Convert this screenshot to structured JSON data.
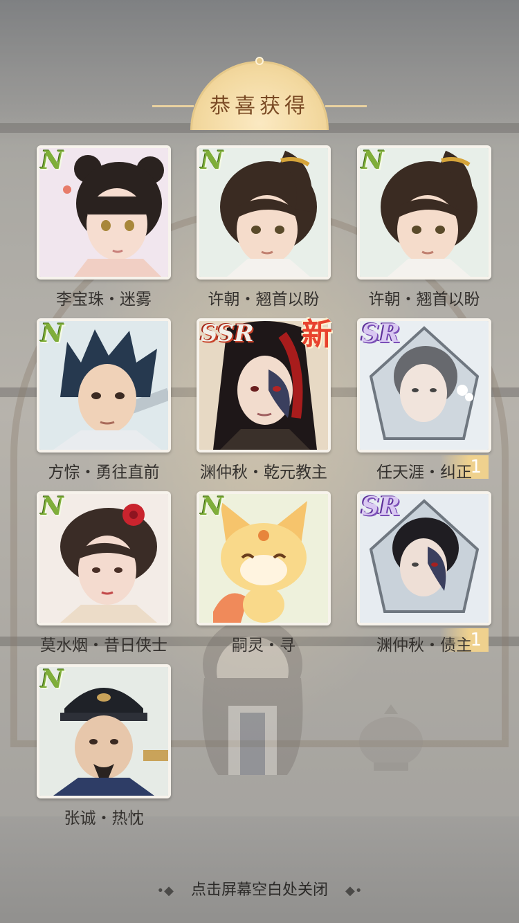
{
  "title": "恭喜获得",
  "footer_hint": "点击屏幕空白处关闭",
  "cards": [
    {
      "rarity": "N",
      "name": "李宝珠・迷雾",
      "portrait": "girl-hair-buns-portrait"
    },
    {
      "rarity": "N",
      "name": "许朝・翘首以盼",
      "portrait": "young-man-ponytail-portrait"
    },
    {
      "rarity": "N",
      "name": "许朝・翘首以盼",
      "portrait": "young-man-ponytail-portrait"
    },
    {
      "rarity": "N",
      "name": "方悰・勇往直前",
      "portrait": "spiky-hair-swordsman-portrait"
    },
    {
      "rarity": "SSR",
      "name": "渊仲秋・乾元教主",
      "portrait": "masked-cult-leader-portrait",
      "badge": "新"
    },
    {
      "rarity": "SR",
      "name": "任天涯・纠正",
      "portrait": "misty-swordsman-portrait",
      "count": "1"
    },
    {
      "rarity": "N",
      "name": "莫水烟・昔日侠士",
      "portrait": "lady-red-flower-portrait"
    },
    {
      "rarity": "N",
      "name": "嗣灵・寻",
      "portrait": "fox-spirit-portrait"
    },
    {
      "rarity": "SR",
      "name": "渊仲秋・债主",
      "portrait": "masked-man-portrait",
      "count": "1"
    },
    {
      "rarity": "N",
      "name": "张诚・热忱",
      "portrait": "official-hat-man-portrait"
    }
  ],
  "colors": {
    "rarity_n": "#7fae3a",
    "rarity_ssr": "#c8432a",
    "rarity_sr": "#7b4fb7",
    "banner": "#f3d9a0",
    "title_text": "#7a4a24"
  }
}
